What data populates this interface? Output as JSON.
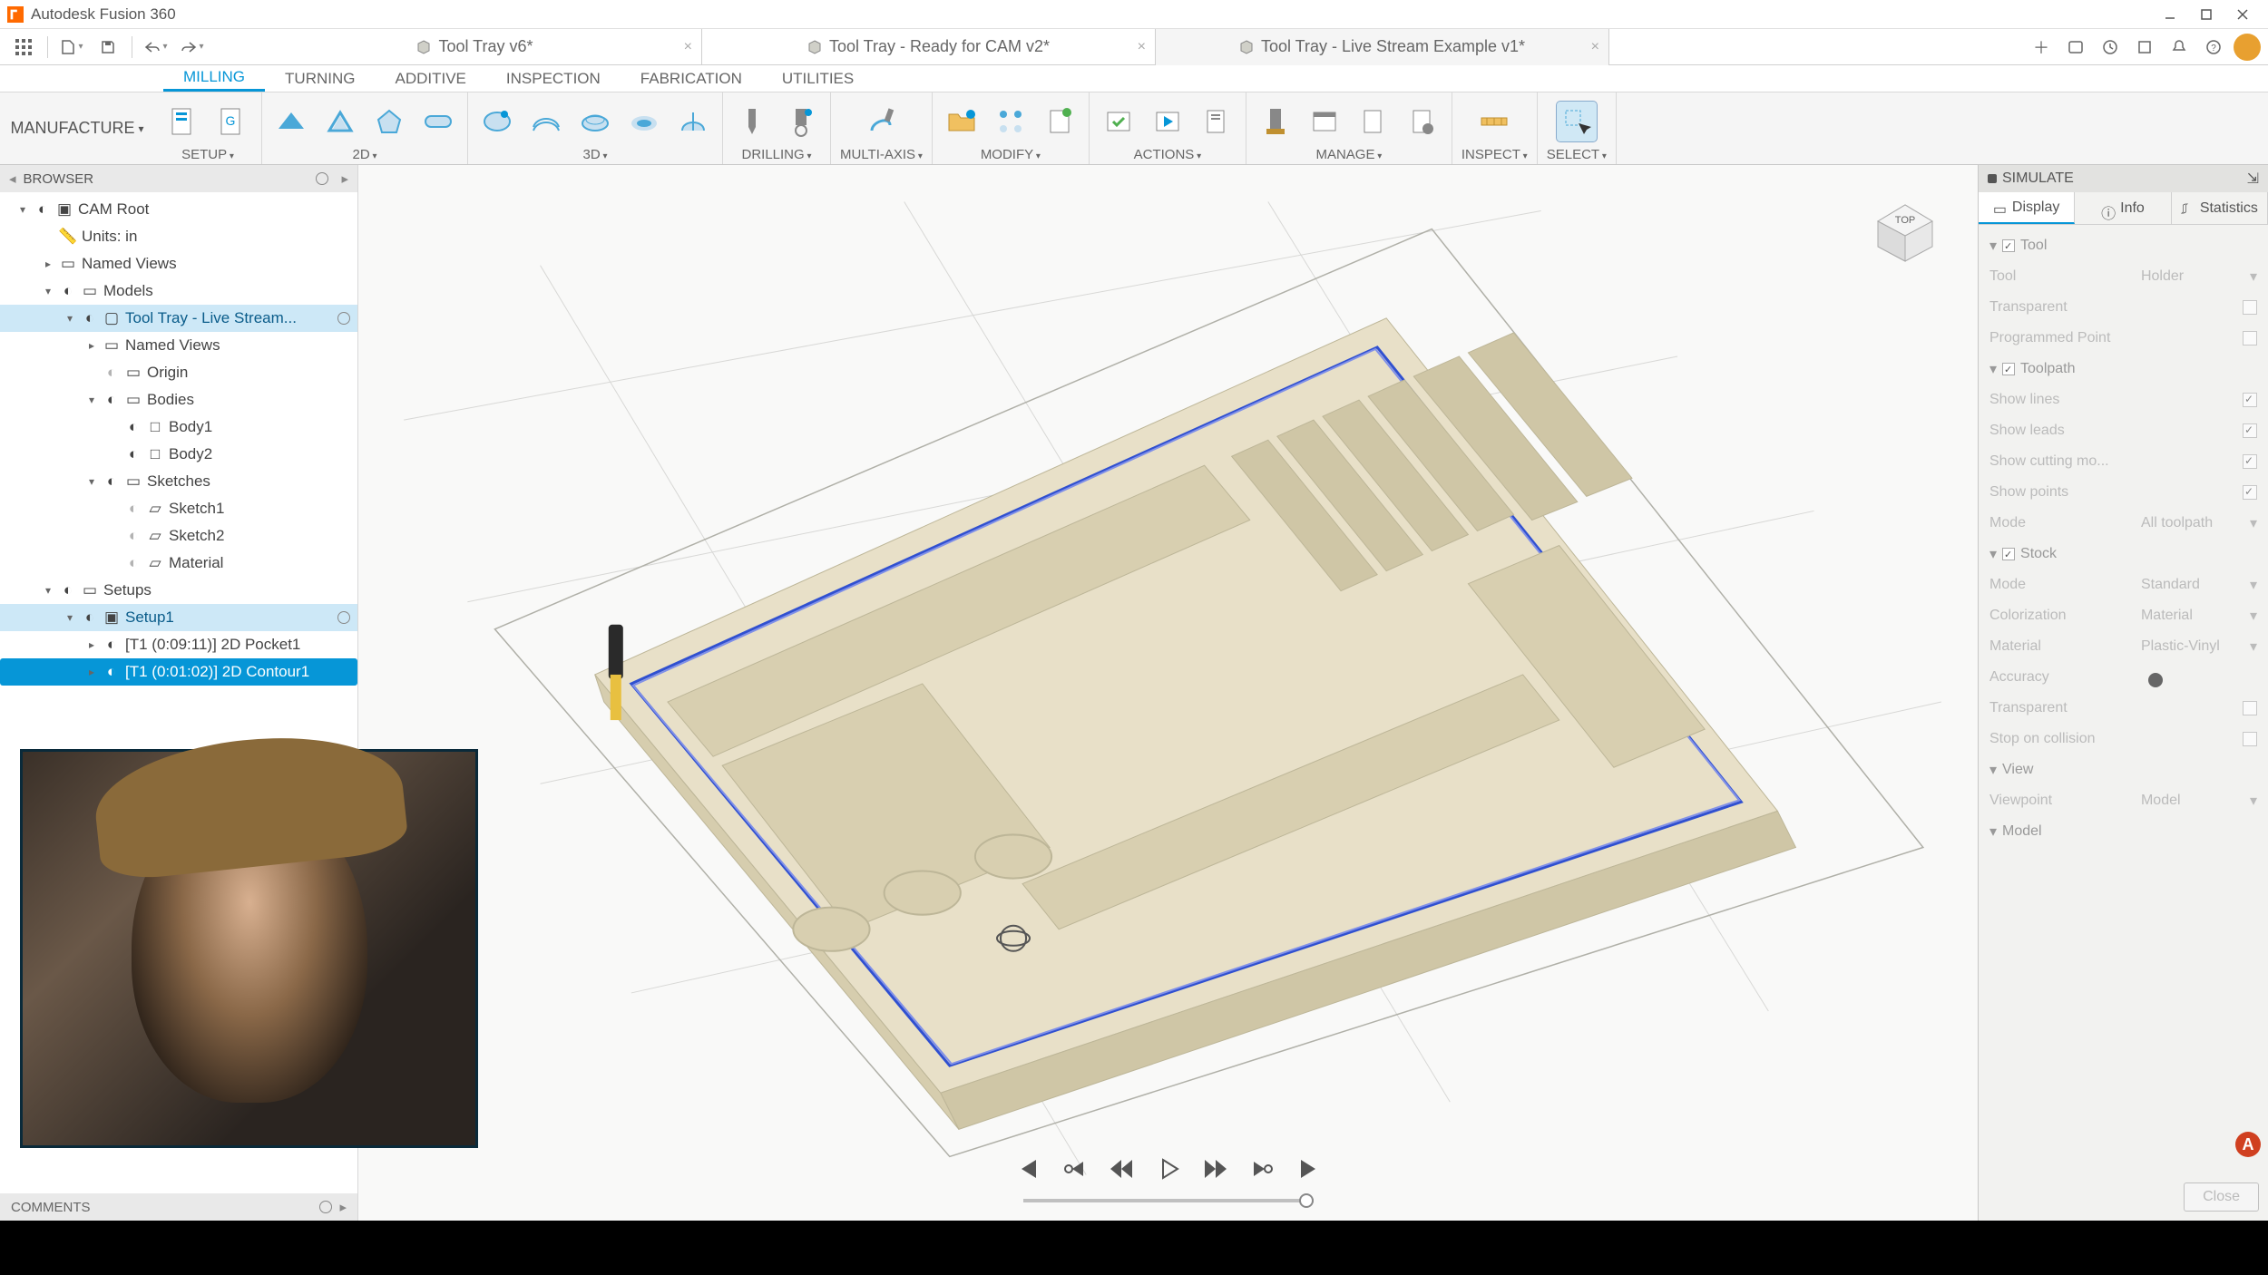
{
  "titlebar": {
    "title": "Autodesk Fusion 360"
  },
  "doc_tabs": [
    {
      "label": "Tool Tray v6*",
      "active": false
    },
    {
      "label": "Tool Tray - Ready for CAM v2*",
      "active": false
    },
    {
      "label": "Tool Tray - Live Stream Example v1*",
      "active": true
    }
  ],
  "ribbon_tabs": [
    "MILLING",
    "TURNING",
    "ADDITIVE",
    "INSPECTION",
    "FABRICATION",
    "UTILITIES"
  ],
  "ribbon_active_tab": "MILLING",
  "workspace": "MANUFACTURE",
  "ribbon_groups": [
    {
      "label": "SETUP",
      "caret": true,
      "icons": [
        "setup-script",
        "setup-sheet"
      ]
    },
    {
      "label": "2D",
      "caret": true,
      "icons": [
        "face",
        "contour-2d",
        "pocket-2d",
        "slot-2d"
      ]
    },
    {
      "label": "3D",
      "caret": true,
      "icons": [
        "adaptive",
        "parallel",
        "scallop",
        "spiral",
        "radial"
      ]
    },
    {
      "label": "DRILLING",
      "caret": true,
      "icons": [
        "drill",
        "bore"
      ]
    },
    {
      "label": "MULTI-AXIS",
      "caret": true,
      "icons": [
        "swarf"
      ]
    },
    {
      "label": "MODIFY",
      "caret": true,
      "icons": [
        "new-folder",
        "pattern",
        "manual-nc"
      ]
    },
    {
      "label": "ACTIONS",
      "caret": true,
      "icons": [
        "generate",
        "simulate",
        "post-process"
      ]
    },
    {
      "label": "MANAGE",
      "caret": true,
      "icons": [
        "tool-library",
        "task-manager",
        "machine-library",
        "template-library"
      ]
    },
    {
      "label": "INSPECT",
      "caret": true,
      "icons": [
        "measure"
      ]
    },
    {
      "label": "SELECT",
      "caret": true,
      "icons": [
        "select"
      ]
    }
  ],
  "browser": {
    "title": "BROWSER",
    "tree": {
      "root": "CAM Root",
      "units": "Units: in",
      "named_views": "Named Views",
      "models": "Models",
      "model_name": "Tool Tray - Live Stream...",
      "model_children": {
        "named_views": "Named Views",
        "origin": "Origin",
        "bodies": "Bodies",
        "body1": "Body1",
        "body2": "Body2",
        "sketches": "Sketches",
        "sketch1": "Sketch1",
        "sketch2": "Sketch2",
        "material": "Material"
      },
      "setups": "Setups",
      "setup1": "Setup1",
      "op1": "[T1 (0:09:11)] 2D Pocket1",
      "op2": "[T1 (0:01:02)] 2D Contour1"
    }
  },
  "simulate": {
    "title": "SIMULATE",
    "tabs": [
      "Display",
      "Info",
      "Statistics"
    ],
    "active_tab": "Display",
    "sections": {
      "tool": {
        "title": "Tool",
        "tool_label": "Tool",
        "tool_value": "Holder",
        "transparent": "Transparent",
        "programmed_point": "Programmed Point"
      },
      "toolpath": {
        "title": "Toolpath",
        "show_lines": "Show lines",
        "show_leads": "Show leads",
        "show_cutting": "Show cutting mo...",
        "show_points": "Show points",
        "mode": "Mode",
        "mode_value": "All toolpath"
      },
      "stock": {
        "title": "Stock",
        "mode": "Mode",
        "mode_value": "Standard",
        "colorization": "Colorization",
        "colorization_value": "Material",
        "material": "Material",
        "material_value": "Plastic-Vinyl",
        "accuracy": "Accuracy",
        "transparent": "Transparent",
        "stop_on_collision": "Stop on collision"
      },
      "view": {
        "title": "View",
        "viewpoint": "Viewpoint",
        "viewpoint_value": "Model"
      },
      "model": {
        "title": "Model"
      }
    },
    "close": "Close"
  },
  "comments": "COMMENTS",
  "viewcube": "TOP",
  "help_badge": "A"
}
